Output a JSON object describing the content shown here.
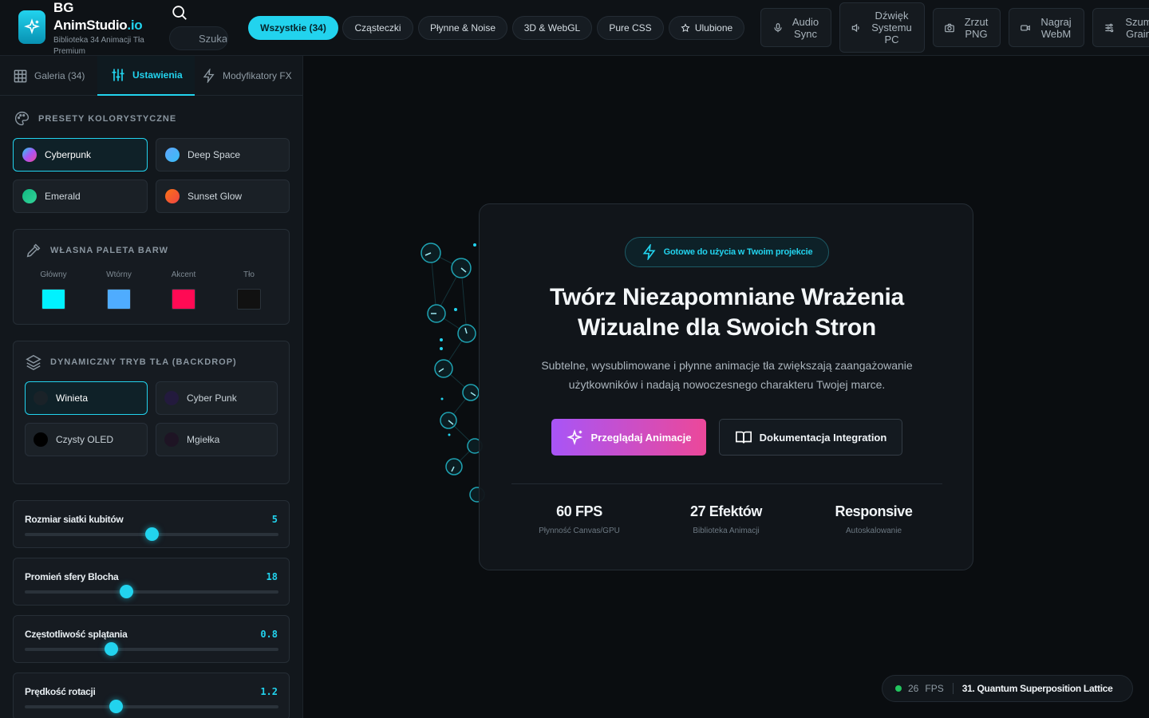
{
  "brand": {
    "top": "BG",
    "name": "AnimStudio",
    "suffix": ".io",
    "subtitle": "Biblioteka 34 Animacji Tła Premium"
  },
  "search": {
    "placeholder": "Szukaj"
  },
  "filters": [
    "Wszystkie (34)",
    "Cząsteczki",
    "Płynne & Noise",
    "3D & WebGL",
    "Pure CSS",
    "Ulubione"
  ],
  "tools": [
    "Audio Sync",
    "Dźwięk Systemu PC",
    "Zrzut PNG",
    "Nagraj WebM",
    "Szum Grain"
  ],
  "tabs": [
    "Galeria (34)",
    "Ustawienia",
    "Modyfikatory FX"
  ],
  "presets": {
    "title": "PRESETY KOLORYSTYCZNE",
    "items": [
      {
        "label": "Cyberpunk",
        "active": true
      },
      {
        "label": "Deep Space"
      },
      {
        "label": "Emerald"
      },
      {
        "label": "Sunset Glow"
      }
    ]
  },
  "palette": {
    "title": "WŁASNA PALETA BARW",
    "swatches": [
      {
        "label": "Główny",
        "color": "#00f2ff"
      },
      {
        "label": "Wtórny",
        "color": "#4facfe"
      },
      {
        "label": "Akcent",
        "color": "#ff0a54"
      },
      {
        "label": "Tło",
        "color": "#111111"
      }
    ]
  },
  "backdrop": {
    "title": "DYNAMICZNY TRYB TŁA (BACKDROP)",
    "items": [
      {
        "label": "Winieta",
        "active": true
      },
      {
        "label": "Cyber Punk"
      },
      {
        "label": "Czysty OLED"
      },
      {
        "label": "Mgiełka"
      }
    ]
  },
  "sliders": [
    {
      "label": "Rozmiar siatki kubitów",
      "value": "5",
      "fraction": 0.5
    },
    {
      "label": "Promień sfery Blocha",
      "value": "18",
      "fraction": 0.4
    },
    {
      "label": "Częstotliwość splątania",
      "value": "0.8",
      "fraction": 0.34
    },
    {
      "label": "Prędkość rotacji",
      "value": "1.2",
      "fraction": 0.36
    }
  ],
  "hero": {
    "badge": "Gotowe do użycia w Twoim projekcie",
    "title": "Twórz Niezapomniane Wrażenia Wizualne dla Swoich Stron",
    "subtitle": "Subtelne, wysublimowane i płynne animacje tła zwiększają zaangażowanie użytkowników i nadają nowoczesnego charakteru Twojej marce.",
    "primary_button": "Przeglądaj Animacje",
    "secondary_button": "Dokumentacja Integration",
    "stats": [
      {
        "value": "60 FPS",
        "label": "Płynność Canvas/GPU"
      },
      {
        "value": "27 Efektów",
        "label": "Biblioteka Animacji"
      },
      {
        "value": "Responsive",
        "label": "Autoskalowanie"
      }
    ]
  },
  "status": {
    "fps": "26",
    "fps_unit": "FPS",
    "animation": "31. Quantum Superposition Lattice"
  },
  "colors": {
    "accent": "#22d3ee",
    "gradient_start": "#a855f7",
    "gradient_end": "#ec4899"
  }
}
